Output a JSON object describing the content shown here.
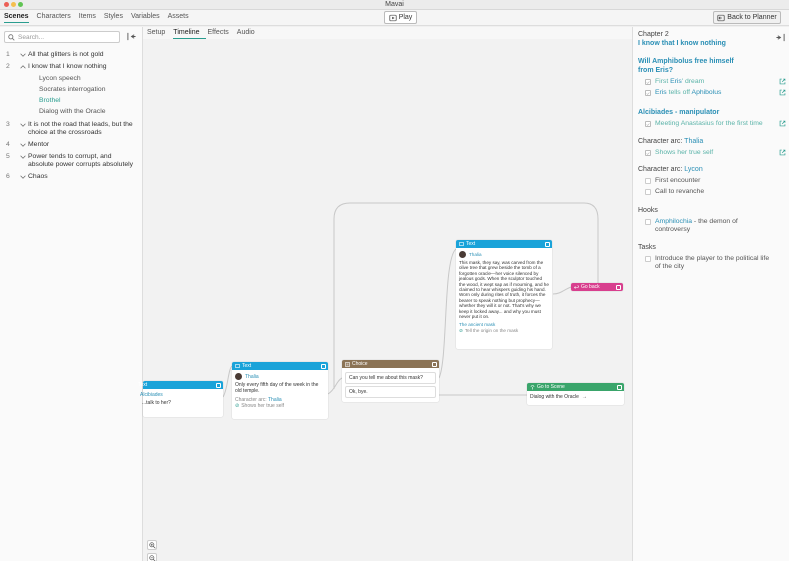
{
  "app": {
    "title": "Mavai"
  },
  "traffic_colors": {
    "close": "#ec5f56",
    "minimize": "#f4bf4f",
    "zoom": "#61c454"
  },
  "accent_color": "#2a9d8f",
  "main_tabs": [
    "Scenes",
    "Characters",
    "Items",
    "Styles",
    "Variables",
    "Assets"
  ],
  "toolbar": {
    "play_label": "Play",
    "back_label": "Back to Planner"
  },
  "sidebar": {
    "search_placeholder": "Search...",
    "scenes": [
      {
        "num": "1",
        "label": "All that glitters is not gold",
        "expanded": false
      },
      {
        "num": "2",
        "label": "I know that I know nothing",
        "expanded": true,
        "children": [
          "Lycon speech",
          "Socrates interrogation",
          "Brothel",
          "Dialog with the Oracle"
        ]
      },
      {
        "num": "3",
        "label": "It is not the road that leads, but the choice at the crossroads",
        "expanded": false
      },
      {
        "num": "4",
        "label": "Mentor",
        "expanded": false
      },
      {
        "num": "5",
        "label": "Power tends to corrupt, and absolute power corrupts absolutely",
        "expanded": false
      },
      {
        "num": "6",
        "label": "Chaos",
        "expanded": false
      }
    ],
    "active_child": "Brothel"
  },
  "sub_tabs": [
    "Setup",
    "Timeline",
    "Effects",
    "Audio"
  ],
  "nodes": {
    "left_text": {
      "type": "Text",
      "character": "Alcibiades",
      "body": "...talk to her?"
    },
    "text1": {
      "type": "Text",
      "character": "Thalia",
      "body": "Only every fifth day of the week in the old temple.",
      "arc_label": "Character arc:",
      "arc_value": "Thalia",
      "arc_item": "Shows her true self"
    },
    "choice": {
      "type": "Choice",
      "option1": "Can you tell me about this mask?",
      "option2": "Ok, bye."
    },
    "text2": {
      "type": "Text",
      "character": "Thalia",
      "body": "This mask, they say, was carved from the olive tree that grew beside the tomb of a forgotten oracle—her voice silenced by jealous gods. When the sculptor touched the wood, it wept sap as if mourning, and he claimed to hear whispers guiding his hand. Worn only during rites of truth, it forces the bearer to speak nothing but prophecy—whether they will it or not. That's why we keep it locked away... and why you must never put it on.",
      "item": "The ancient mask",
      "item_action": "Tell the origin on the mask"
    },
    "goback": {
      "type": "Go back"
    },
    "goto": {
      "type": "Go to Scene",
      "target": "Dialog with the Oracle",
      "arrow": "→"
    }
  },
  "right_panel": {
    "chapter": "Chapter 2",
    "title": "I know that I know nothing",
    "sections": [
      {
        "heading": "Will Amphibolus free himself from Eris?",
        "items": [
          {
            "pre": "First ",
            "link": "Eris",
            "post": "' dream",
            "done": true
          },
          {
            "pre": "",
            "link": "Eris",
            "mid": " tells off ",
            "link2": "Aphibolus",
            "done": true
          }
        ]
      },
      {
        "heading": "Alcibiades - manipulator",
        "items": [
          {
            "pre": "Meeting Anastasius for the first time",
            "done": true
          }
        ]
      },
      {
        "heading_pre": "Character arc: ",
        "heading_link": "Thalia",
        "items": [
          {
            "pre": "Shows her true self",
            "done": true
          }
        ]
      },
      {
        "heading_pre": "Character arc: ",
        "heading_link": "Lycon",
        "items": [
          {
            "pre": "First encounter",
            "done": false
          },
          {
            "pre": "Call to revanche",
            "done": false
          }
        ]
      },
      {
        "heading_plain": "Hooks",
        "items": [
          {
            "link": "Amphilochia",
            "post": " - the demon of controversy",
            "done": false
          }
        ]
      },
      {
        "heading_plain": "Tasks",
        "items": [
          {
            "pre": "Introduce the player to the political life of the city",
            "done": false
          }
        ]
      }
    ]
  }
}
